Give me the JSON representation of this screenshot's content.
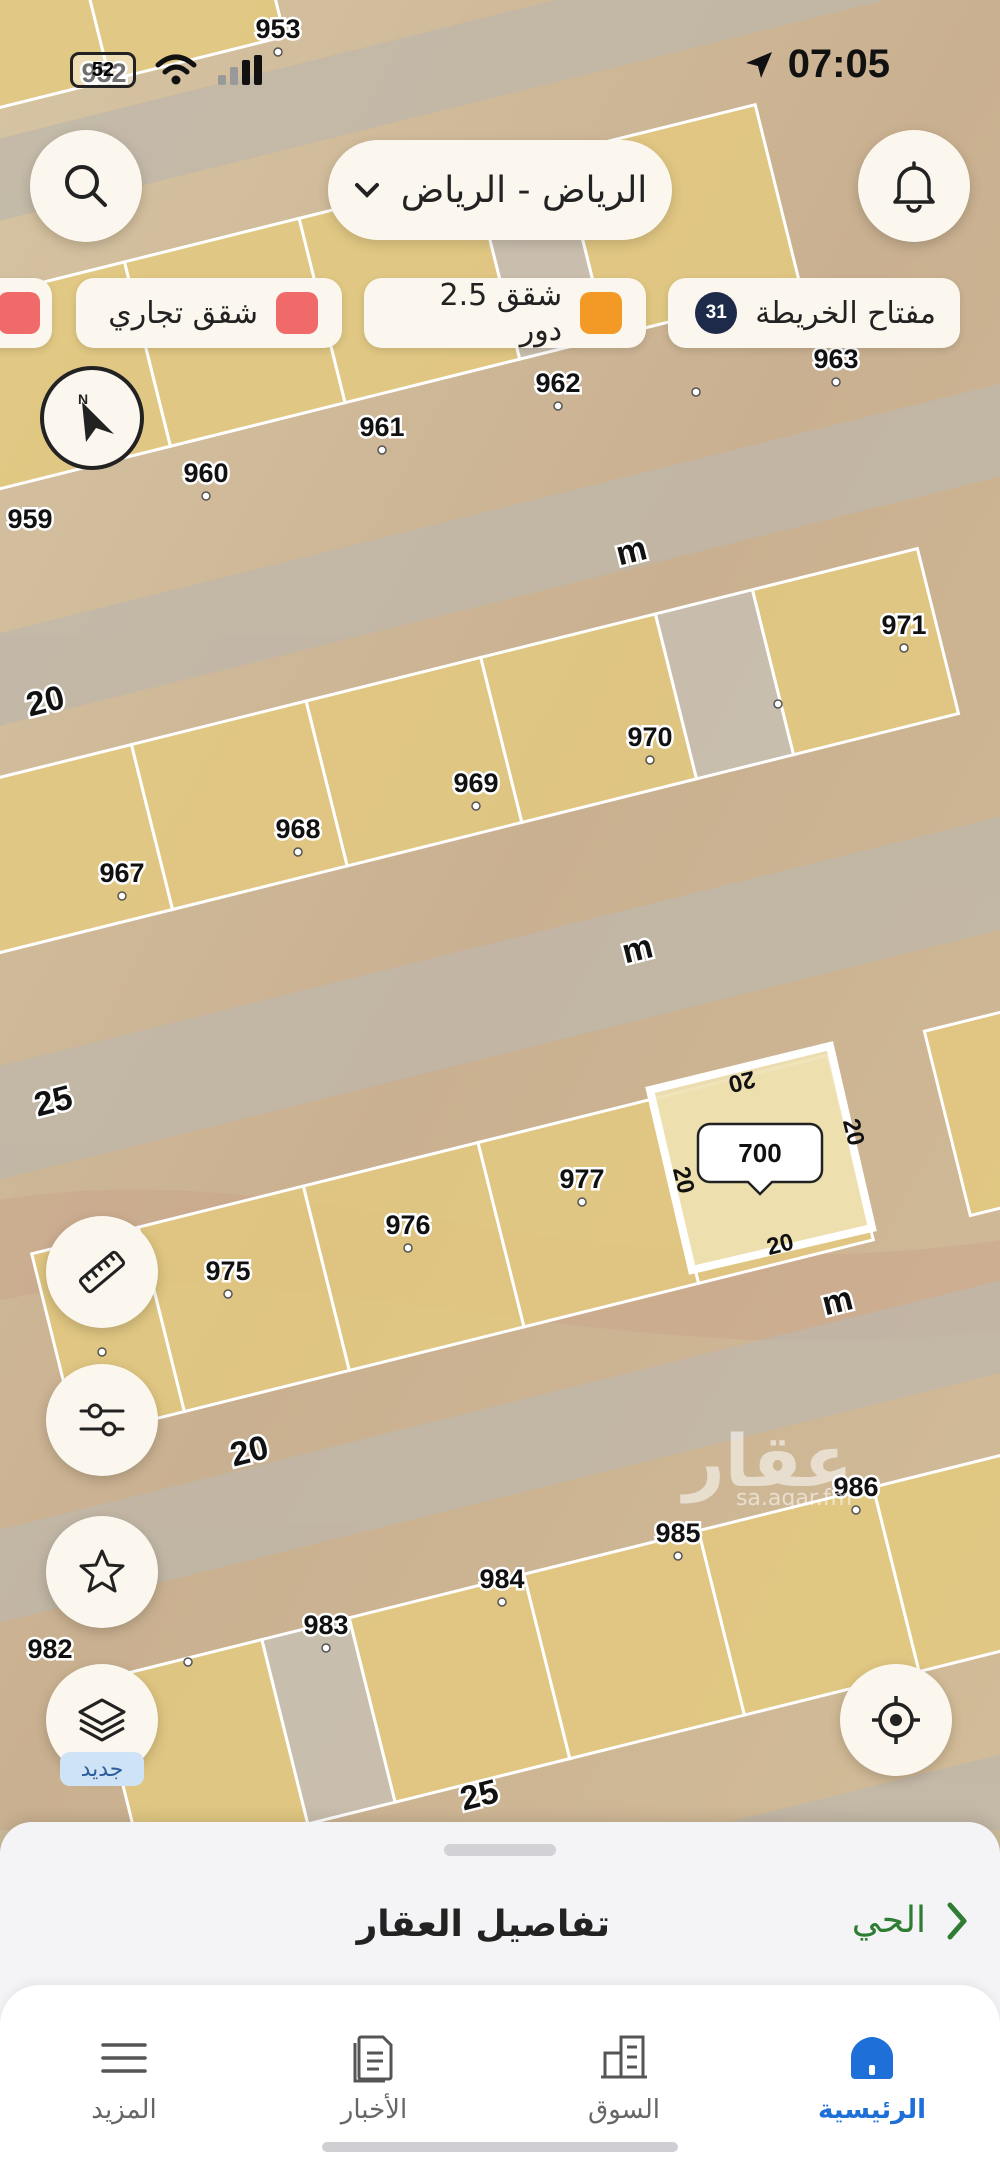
{
  "status": {
    "time": "07:05",
    "battery": "52"
  },
  "header": {
    "city": "الرياض - الرياض"
  },
  "chips": [
    {
      "label": "مفتاح الخريطة",
      "badge": "31"
    },
    {
      "label": "شقق 2.5 دور",
      "color": "#f39a26"
    },
    {
      "label": "شقق تجاري",
      "color": "#f06a6a"
    }
  ],
  "map": {
    "plots": [
      "953",
      "952",
      "963",
      "962",
      "961",
      "960",
      "959",
      "971",
      "970",
      "969",
      "968",
      "967",
      "977",
      "976",
      "975",
      "986",
      "985",
      "984",
      "983",
      "982"
    ],
    "selected_plot": "700",
    "selected_dims": [
      "20",
      "20",
      "20",
      "20"
    ],
    "street_widths": [
      "20",
      "25",
      "20",
      "25"
    ],
    "street_marks": [
      "m",
      "m",
      "m",
      "m"
    ],
    "watermark": "عقار",
    "watermark_url": "sa.aqar.fm"
  },
  "side_tools": {
    "new_label": "جديد"
  },
  "sheet": {
    "title": "تفاصيل العقار",
    "district_link": "الحي"
  },
  "tabs": [
    {
      "label": "الرئيسية",
      "active": true
    },
    {
      "label": "السوق"
    },
    {
      "label": "الأخبار"
    },
    {
      "label": "المزيد"
    }
  ],
  "colors": {
    "plot_fill": "#e3c97f",
    "accent": "#1e6fd8",
    "district_green": "#2e7d32"
  }
}
